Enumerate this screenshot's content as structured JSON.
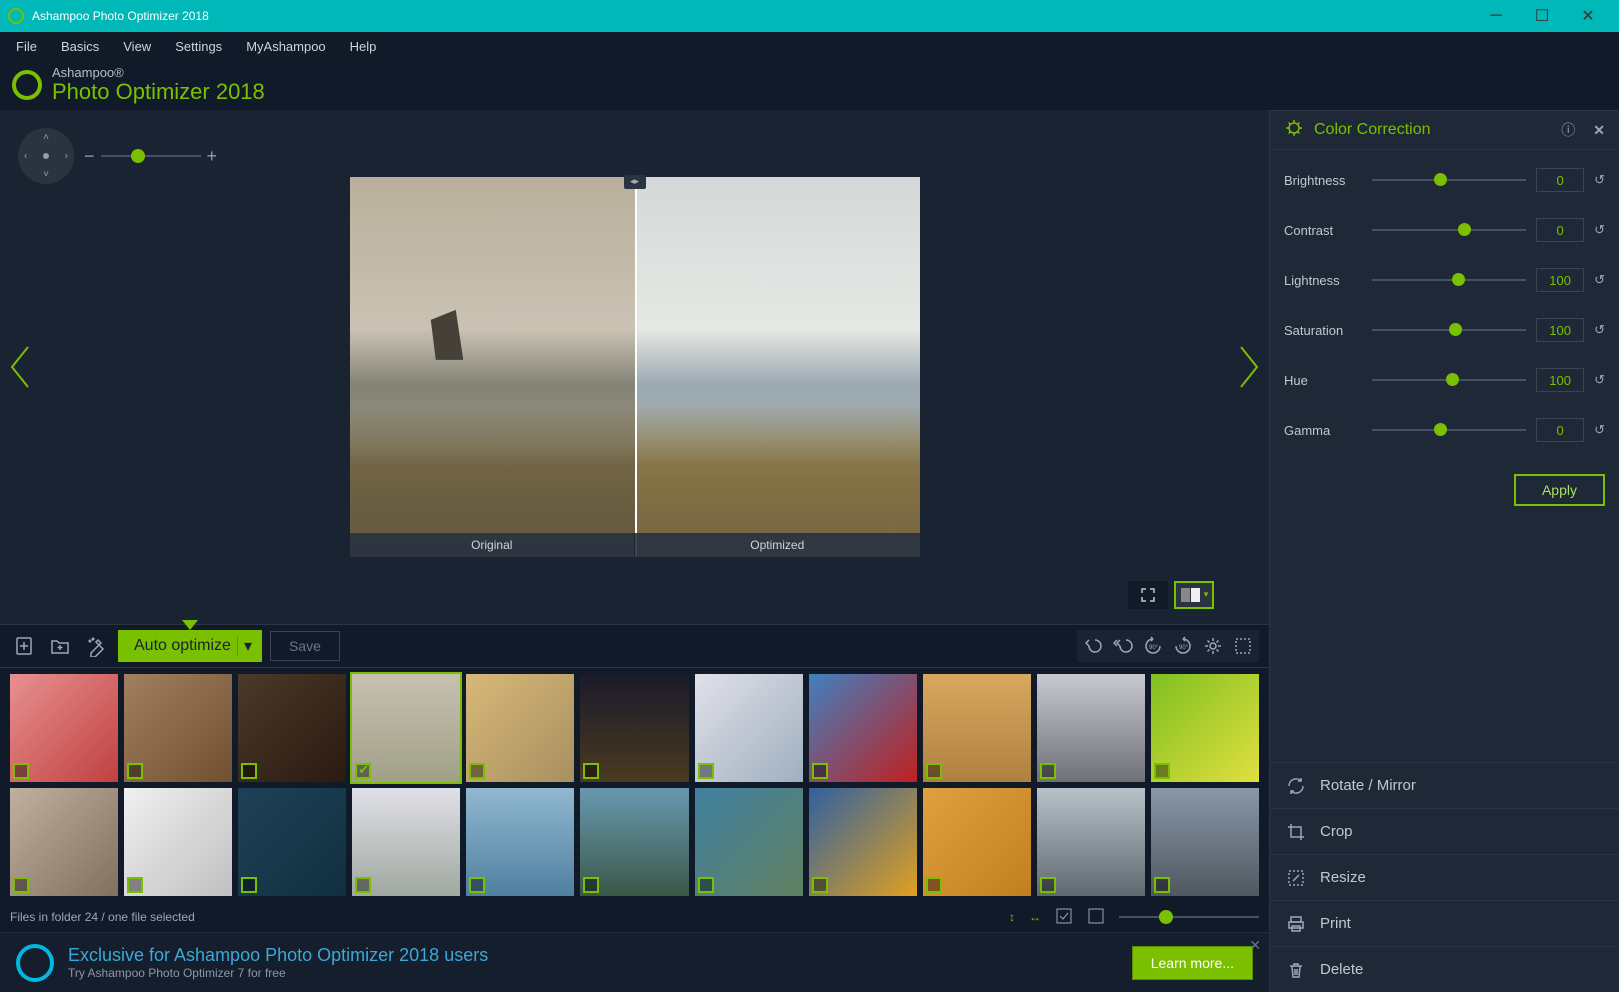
{
  "window": {
    "title": "Ashampoo Photo Optimizer 2018"
  },
  "menu": {
    "items": [
      "File",
      "Basics",
      "View",
      "Settings",
      "MyAshampoo",
      "Help"
    ]
  },
  "brand": {
    "line1": "Ashampoo®",
    "line2": "Photo Optimizer 2018"
  },
  "preview": {
    "original_label": "Original",
    "optimized_label": "Optimized"
  },
  "toolbar": {
    "auto_optimize": "Auto optimize",
    "save": "Save"
  },
  "status": {
    "text": "Files in folder 24 / one file selected"
  },
  "promo": {
    "headline": "Exclusive for Ashampoo Photo Optimizer 2018 users",
    "subline": "Try Ashampoo Photo Optimizer 7 for free",
    "cta": "Learn more..."
  },
  "panel": {
    "title": "Color Correction",
    "apply": "Apply",
    "params": [
      {
        "label": "Brightness",
        "value": "0",
        "pos": 40
      },
      {
        "label": "Contrast",
        "value": "0",
        "pos": 56
      },
      {
        "label": "Lightness",
        "value": "100",
        "pos": 52
      },
      {
        "label": "Saturation",
        "value": "100",
        "pos": 50
      },
      {
        "label": "Hue",
        "value": "100",
        "pos": 48
      },
      {
        "label": "Gamma",
        "value": "0",
        "pos": 40
      }
    ]
  },
  "actions": {
    "rotate": "Rotate / Mirror",
    "crop": "Crop",
    "resize": "Resize",
    "print": "Print",
    "delete": "Delete"
  },
  "thumbs": {
    "selected_index": 3,
    "checked_index": 3,
    "count": 22
  }
}
